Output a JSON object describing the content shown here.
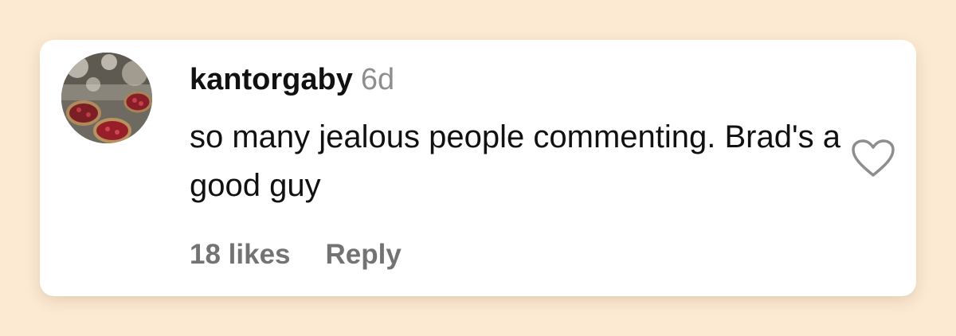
{
  "comment": {
    "username": "kantorgaby",
    "timestamp": "6d",
    "text": "so many jealous people commenting. Brad's a good guy",
    "likes_label": "18 likes",
    "reply_label": "Reply",
    "like_icon": "heart-outline"
  },
  "colors": {
    "page_background": "#fcead3",
    "card_background": "#ffffff",
    "primary_text": "#111111",
    "secondary_text": "#737373"
  }
}
